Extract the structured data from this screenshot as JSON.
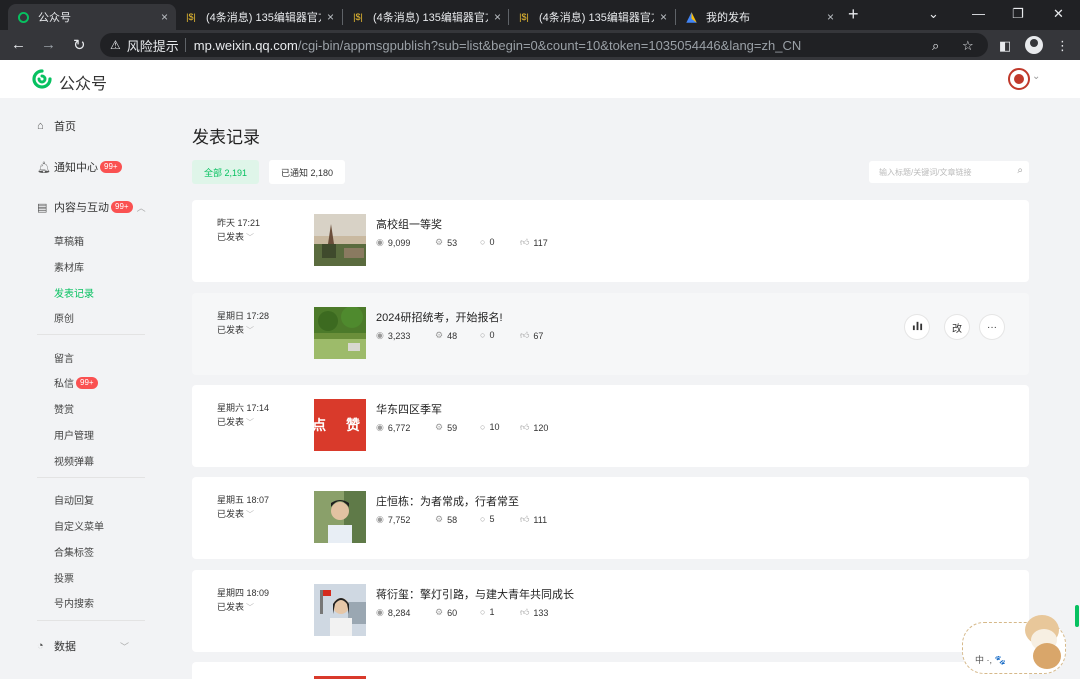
{
  "browser": {
    "tabs": [
      {
        "title": "公众号",
        "close": "×"
      },
      {
        "title": "(4条消息) 135编辑器官方",
        "close": "×"
      },
      {
        "title": "(4条消息) 135编辑器官方",
        "close": "×"
      },
      {
        "title": "(4条消息) 135编辑器官方",
        "close": "×"
      },
      {
        "title": "我的发布",
        "close": "×"
      }
    ],
    "new_tab": "+",
    "risk_label": "风险提示",
    "url_host": "mp.weixin.qq.com",
    "url_path": "/cgi-bin/appmsgpublish?sub=list&begin=0&count=10&token=1035054446&lang=zh_CN"
  },
  "app": {
    "brand": "公众号"
  },
  "sidebar": {
    "home": "首页",
    "notifications": {
      "label": "通知中心",
      "badge": "99+"
    },
    "content": {
      "label": "内容与互动",
      "badge": "99+"
    },
    "content_items": [
      "草稿箱",
      "素材库",
      "发表记录",
      "原创"
    ],
    "interaction_items": [
      "留言",
      "私信",
      "赞赏",
      "用户管理",
      "视频弹幕"
    ],
    "messages_badge": "99+",
    "function_items": [
      "自动回复",
      "自定义菜单",
      "合集标签",
      "投票",
      "号内搜索"
    ],
    "data": "数据"
  },
  "main": {
    "title": "发表记录",
    "filter_all": "全部 2,191",
    "filter_notified": "已通知 2,180",
    "search_placeholder": "输入标题/关键词/文章链接",
    "hover_actions": {
      "stats": "📊",
      "edit": "改",
      "more": "···"
    },
    "articles": [
      {
        "time": "昨天 17:21",
        "status": "已发表",
        "title": "高校组一等奖",
        "views": "9,099",
        "shares": "53",
        "comments": "0",
        "likes": "117"
      },
      {
        "time": "星期日 17:28",
        "status": "已发表",
        "title": "2024研招统考，开始报名!",
        "views": "3,233",
        "shares": "48",
        "comments": "0",
        "likes": "67"
      },
      {
        "time": "星期六 17:14",
        "status": "已发表",
        "title": "华东四区季军",
        "views": "6,772",
        "shares": "59",
        "comments": "10",
        "likes": "120"
      },
      {
        "time": "星期五 18:07",
        "status": "已发表",
        "title": "庄恒栋：为者常成，行者常至",
        "views": "7,752",
        "shares": "58",
        "comments": "5",
        "likes": "111"
      },
      {
        "time": "星期四 18:09",
        "status": "已发表",
        "title": "蒋衍玺：擎灯引路，与建大青年共同成长",
        "views": "8,284",
        "shares": "60",
        "comments": "1",
        "likes": "133"
      }
    ],
    "thumb3_text": "点 赞"
  },
  "widget": {
    "text": "中 ·, 🐾"
  }
}
